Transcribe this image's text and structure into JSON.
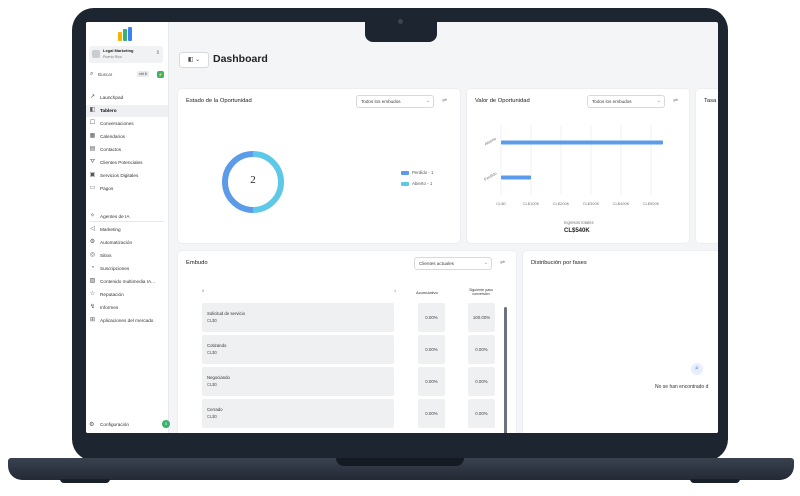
{
  "app": {
    "account_name": "Legal Marketing",
    "account_location": "Puerto Rico",
    "search_label": "Buscar",
    "search_shortcut": "ctrl K"
  },
  "sidebar": {
    "items": [
      {
        "label": "Launchpad",
        "icon": "rocket-icon"
      },
      {
        "label": "Tablero",
        "icon": "dashboard-icon",
        "active": true
      },
      {
        "label": "Conversaciones",
        "icon": "chat-icon"
      },
      {
        "label": "Calendarios",
        "icon": "calendar-icon"
      },
      {
        "label": "Contactos",
        "icon": "contacts-icon"
      },
      {
        "label": "Clientes Potenciales",
        "icon": "filter-icon"
      },
      {
        "label": "Servicios Digitales",
        "icon": "services-icon"
      },
      {
        "label": "Pagos",
        "icon": "payments-icon"
      }
    ],
    "items2": [
      {
        "label": "Agentes de IA",
        "icon": "ai-agent-icon"
      },
      {
        "label": "Marketing",
        "icon": "megaphone-icon"
      },
      {
        "label": "Automatización",
        "icon": "automation-icon"
      },
      {
        "label": "Sitios",
        "icon": "globe-icon"
      },
      {
        "label": "Suscripciones",
        "icon": "subscriptions-icon"
      },
      {
        "label": "Contenido multimedia IA...",
        "icon": "media-icon"
      },
      {
        "label": "Reputación",
        "icon": "star-icon"
      },
      {
        "label": "Informes",
        "icon": "reports-icon"
      },
      {
        "label": "Aplicaciones del mercado",
        "icon": "apps-icon"
      }
    ],
    "settings_label": "Configuración",
    "settings_badge": "0"
  },
  "header": {
    "title": "Dashboard"
  },
  "cards": {
    "estado": {
      "title": "Estado de la Oportunidad",
      "filter": "Todos los embudos",
      "center_value": "2",
      "legend": [
        {
          "label": "Perdido - 1",
          "color": "#5b9bea"
        },
        {
          "label": "Abierto - 1",
          "color": "#5ec8e8"
        }
      ]
    },
    "valor": {
      "title": "Valor de Oportunidad",
      "filter": "Todos los embudos",
      "categories": [
        "Abierto",
        "Perdido"
      ],
      "xlabel": "Ingresos totales",
      "total": "CL$540K"
    },
    "tasa": {
      "title": "Tasa"
    },
    "embudo": {
      "title": "Embudo",
      "filter": "Clientes actuales",
      "col_acumulativo": "Acumulativo",
      "col_siguiente": "Siguiente paso conversión",
      "axis_start": "0",
      "axis_end": "1",
      "rows": [
        {
          "name": "Solicitud de servicio",
          "value": "CL$0",
          "acum": "0.00%",
          "sig": "100.00%"
        },
        {
          "name": "Cotizando",
          "value": "CL$0",
          "acum": "0.00%",
          "sig": "0.00%"
        },
        {
          "name": "Negociando",
          "value": "CL$0",
          "acum": "0.00%",
          "sig": "0.00%"
        },
        {
          "name": "Cerrado",
          "value": "CL$0",
          "acum": "0.00%",
          "sig": "0.00%"
        }
      ]
    },
    "distribucion": {
      "title": "Distribución por fases",
      "empty": "No se han encontrado d"
    }
  },
  "chart_data": [
    {
      "type": "pie",
      "title": "Estado de la Oportunidad",
      "categories": [
        "Perdido",
        "Abierto"
      ],
      "values": [
        1,
        1
      ]
    },
    {
      "type": "bar",
      "title": "Valor de Oportunidad",
      "orientation": "horizontal",
      "categories": [
        "Abierto",
        "Perdido"
      ],
      "values": [
        540000,
        100000
      ],
      "xlabel": "Ingresos totales",
      "xticks": [
        "CL$0",
        "CL$100K",
        "CL$200K",
        "CL$300K",
        "CL$400K",
        "CL$500K"
      ],
      "xlim": [
        0,
        600000
      ],
      "grid": true
    }
  ]
}
